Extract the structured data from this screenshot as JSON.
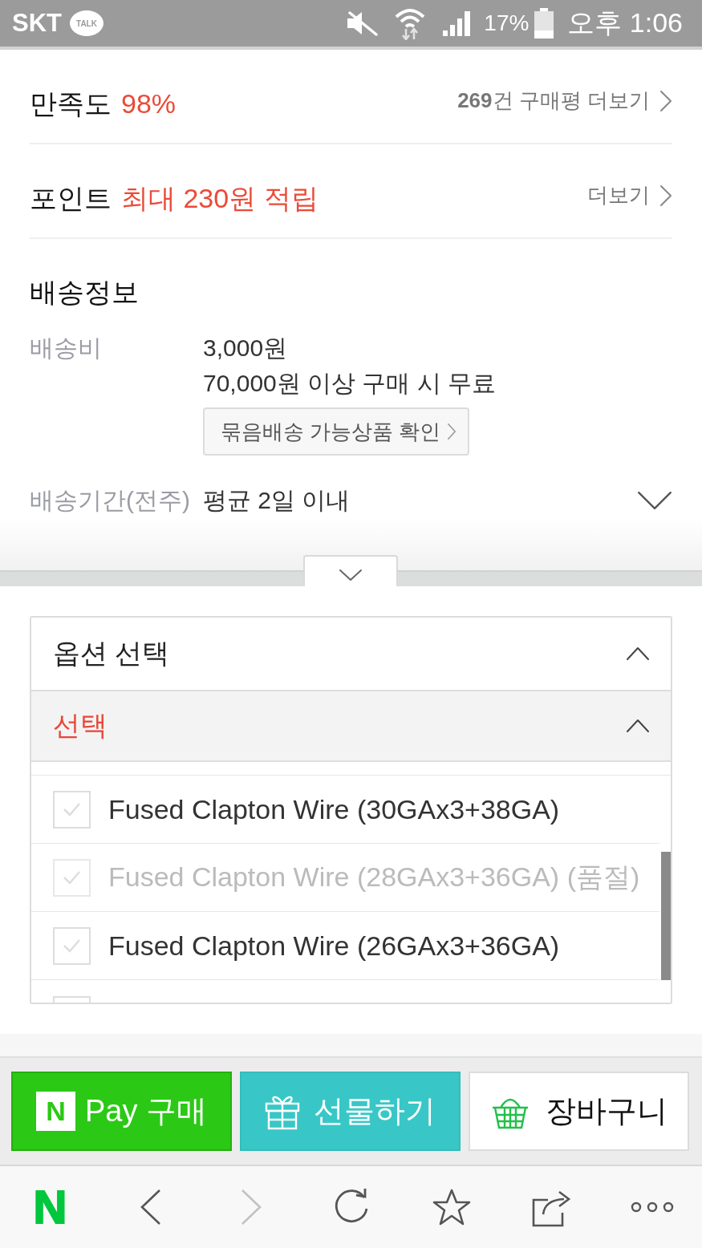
{
  "status_bar": {
    "carrier": "SKT",
    "talk_badge": "TALK",
    "battery": "17%",
    "time": "오후 1:06"
  },
  "summary_rows": [
    {
      "label": "만족도",
      "value": "98%",
      "link": "**269**건 구매평 더보기"
    },
    {
      "label": "포인트",
      "value": "최대 230원 적립",
      "link": "더보기"
    }
  ],
  "shipping": {
    "title": "배송정보",
    "fee": {
      "label": "배송비",
      "lines": [
        "3,000원",
        "70,000원 이상 구매 시 무료"
      ],
      "button": "묶음배송 가능상품 확인"
    },
    "period": {
      "label": "배송기간(전주)",
      "value": "평균 2일 이내",
      "expanded": false
    }
  },
  "fold_tab": {
    "expanded": false
  },
  "option_panel": {
    "title": "옵션 선택",
    "expanded": true,
    "select": {
      "label": "선택",
      "expanded": true
    },
    "options": [
      {
        "label": "Fused Clapton Wire (30GAx3+38GA)",
        "checked": false,
        "disabled": false
      },
      {
        "label": "Fused Clapton Wire (28GAx3+36GA) (품절)",
        "checked": false,
        "disabled": true
      },
      {
        "label": "Fused Clapton Wire (26GAx3+36GA)",
        "checked": false,
        "disabled": false
      },
      {
        "checked": false
      }
    ]
  },
  "actions": [
    {
      "kind": "npay",
      "logo": "N",
      "label": "Pay 구매"
    },
    {
      "kind": "gift",
      "label": "선물하기"
    },
    {
      "kind": "cart",
      "label": "장바구니"
    }
  ],
  "toolbar": [
    {
      "kind": "home",
      "logo": "N",
      "disabled": false
    },
    {
      "kind": "back",
      "disabled": false
    },
    {
      "kind": "forward",
      "disabled": true
    },
    {
      "kind": "reload",
      "disabled": false
    },
    {
      "kind": "bookmark",
      "disabled": false
    },
    {
      "kind": "share",
      "disabled": false
    },
    {
      "kind": "more",
      "disabled": false
    }
  ]
}
